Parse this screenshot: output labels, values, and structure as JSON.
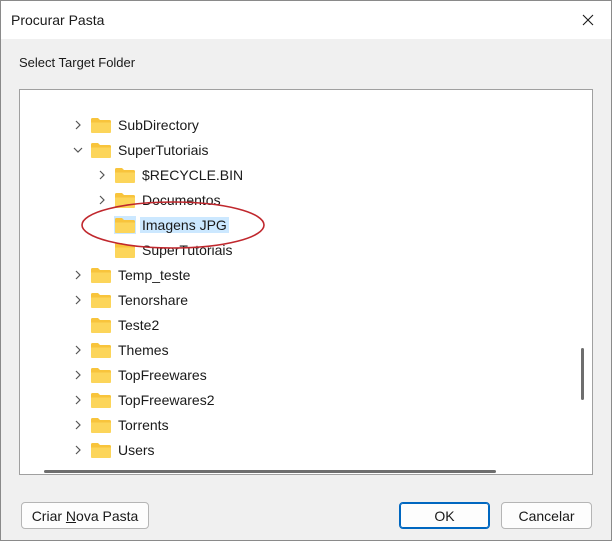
{
  "window": {
    "title": "Procurar Pasta",
    "prompt": "Select Target Folder"
  },
  "tree": {
    "items": [
      {
        "label": "SubDirectory",
        "expanded": false,
        "has_children": true,
        "level": 0
      },
      {
        "label": "SuperTutoriais",
        "expanded": true,
        "has_children": true,
        "level": 0
      },
      {
        "label": "$RECYCLE.BIN",
        "expanded": false,
        "has_children": true,
        "level": 1
      },
      {
        "label": "Documentos",
        "expanded": false,
        "has_children": true,
        "level": 1
      },
      {
        "label": "Imagens JPG",
        "expanded": false,
        "has_children": false,
        "level": 1,
        "selected": true
      },
      {
        "label": "SuperTutoriais",
        "expanded": false,
        "has_children": false,
        "level": 1
      },
      {
        "label": "Temp_teste",
        "expanded": false,
        "has_children": true,
        "level": 0
      },
      {
        "label": "Tenorshare",
        "expanded": false,
        "has_children": true,
        "level": 0
      },
      {
        "label": "Teste2",
        "expanded": false,
        "has_children": false,
        "level": 0
      },
      {
        "label": "Themes",
        "expanded": false,
        "has_children": true,
        "level": 0
      },
      {
        "label": "TopFreewares",
        "expanded": false,
        "has_children": true,
        "level": 0
      },
      {
        "label": "TopFreewares2",
        "expanded": false,
        "has_children": true,
        "level": 0
      },
      {
        "label": "Torrents",
        "expanded": false,
        "has_children": true,
        "level": 0
      },
      {
        "label": "Users",
        "expanded": false,
        "has_children": true,
        "level": 0
      }
    ]
  },
  "buttons": {
    "new_folder_pre": "Criar ",
    "new_folder_mnemonic": "N",
    "new_folder_post": "ova Pasta",
    "ok": "OK",
    "cancel": "Cancelar"
  },
  "colors": {
    "selection": "#cce8ff",
    "folder": "#f8c43c",
    "annotation": "#c0272d",
    "default_button_border": "#0067c0"
  },
  "icons": {
    "close": "close-icon",
    "expand": "chevron-right-icon",
    "collapse": "chevron-down-icon",
    "folder": "folder-icon"
  }
}
